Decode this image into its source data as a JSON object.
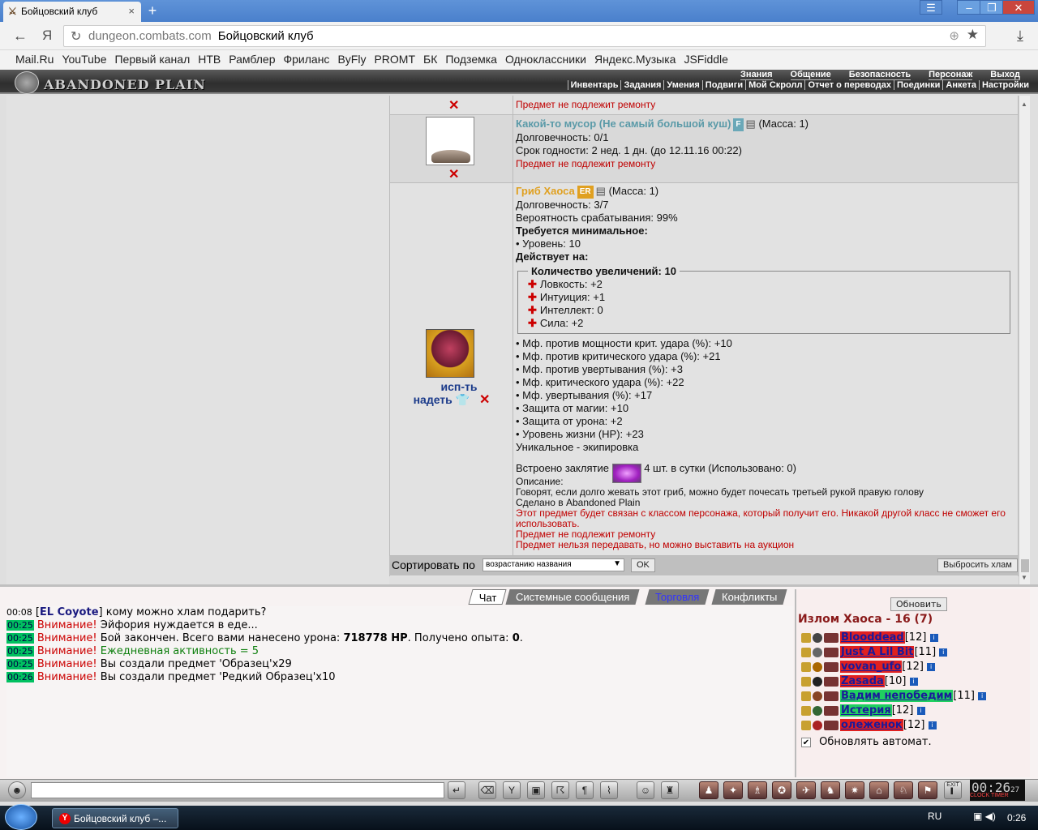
{
  "browser": {
    "tab_title": "Бойцовский клуб",
    "tab_close": "×",
    "new_tab": "+",
    "url_domain": "dungeon.combats.com",
    "url_title": "Бойцовский клуб",
    "yandex_letter": "Я",
    "bookmarks": [
      "Mail.Ru",
      "YouTube",
      "Первый канал",
      "НТВ",
      "Рамблер",
      "Фриланс",
      "ByFly",
      "PROMT",
      "БК",
      "Подземка",
      "Одноклассники",
      "Яндекс.Музыка",
      "JSFiddle"
    ]
  },
  "game": {
    "logo": "ABANDONED PLAIN",
    "top_menu": [
      "Знания",
      "Общение",
      "Безопасность",
      "Персонаж",
      "Выход"
    ],
    "sub_menu": [
      "Инвентарь",
      "Задания",
      "Умения",
      "Подвиги",
      "Мой Скролл",
      "Отчет о переводах",
      "Поединки",
      "Анкета",
      "Настройки"
    ]
  },
  "items": {
    "first_partial": {
      "remove": "✕",
      "no_repair": "Предмет не подлежит ремонту"
    },
    "trash": {
      "name": "Какой-то мусор (Не самый большой куш)",
      "badge": "F",
      "mass": "(Масса: 1)",
      "durability": "Долговечность: 0/1",
      "expiry": "Срок годности: 2 нед. 1 дн. (до 12.11.16 00:22)",
      "no_repair": "Предмет не подлежит ремонту",
      "remove": "✕"
    },
    "mushroom": {
      "name": "Гриб Хаоса",
      "badge": "ER",
      "mass": "(Масса: 1)",
      "durability": "Долговечность: 3/7",
      "chance": "Вероятность срабатывания: 99%",
      "req_title": "Требуется минимальное:",
      "req_level": "• Уровень: 10",
      "acts_title": "Действует на:",
      "upgrades_legend": "Количество увеличений: 10",
      "stats": [
        "Ловкость: +2",
        "Интуиция: +1",
        "Интеллект: 0",
        "Сила: +2"
      ],
      "mods": [
        "• Мф. против мощности крит. удара (%): +10",
        "• Мф. против критического удара (%): +21",
        "• Мф. против увертывания (%): +3",
        "• Мф. критического удара (%): +22",
        "• Мф. увертывания (%): +17",
        "• Защита от магии: +10",
        "• Защита от урона: +2",
        "• Уровень жизни (HP): +23"
      ],
      "unique": "Уникальное - экипировка",
      "spell_prefix": "Встроено заклятие",
      "spell_suffix": "4 шт. в сутки (Использовано: 0)",
      "desc_title": "Описание:",
      "desc": "Говорят, если долго жевать этот гриб, можно будет почесать третьей рукой правую голову",
      "made": "Сделано в Abandoned Plain",
      "bound": "Этот предмет будет связан с классом персонажа, который получит его. Никакой другой класс не сможет его использовать.",
      "no_repair": "Предмет не подлежит ремонту",
      "no_transfer": "Предмет нельзя передавать, но можно выставить на аукцион",
      "use": "исп-ть",
      "wear": "надеть",
      "remove": "✕"
    }
  },
  "sortbar": {
    "label": "Сортировать по",
    "selected": "возрастанию названия",
    "ok": "OK",
    "throw_trash": "Выбросить хлам"
  },
  "chat": {
    "tabs": [
      "Чат",
      "Системные сообщения",
      "Торговля",
      "Конфликты"
    ],
    "lines": [
      {
        "time": "00:08",
        "pre": "[",
        "name": "EL Coyote",
        "post": "] кому можно хлам подарить?"
      },
      {
        "time": "00:25",
        "warn": "Внимание!",
        "text": " Эйфория нуждается в еде..."
      },
      {
        "time": "00:25",
        "warn": "Внимание!",
        "text": " Бой закончен. Всего вами нанесено урона: ",
        "b1": "718778 HP",
        "text2": ". Получено опыта: ",
        "b2": "0",
        "text3": "."
      },
      {
        "time": "00:25",
        "warn": "Внимание!",
        "green": " Ежедневная активность = 5"
      },
      {
        "time": "00:25",
        "warn": "Внимание!",
        "text": " Вы создали предмет 'Образец'x29"
      },
      {
        "time": "00:26",
        "warn": "Внимание!",
        "text": " Вы создали предмет 'Редкий Образец'x10"
      }
    ]
  },
  "room": {
    "refresh": "Обновить",
    "title": "Излом Хаоса - 16 (7)",
    "players": [
      {
        "name": "Blooddead",
        "level": "[12]",
        "bg": "#e02020"
      },
      {
        "name": "Just A Lil Bit",
        "level": "[11]",
        "bg": "#e02020"
      },
      {
        "name": "vovan_ufo",
        "level": "[12]",
        "bg": "#e02020"
      },
      {
        "name": "Zasada",
        "level": "[10]",
        "bg": "#e02020"
      },
      {
        "name": "Вадим непобедим",
        "level": "[11]",
        "bg": "#20d060"
      },
      {
        "name": "Истерия",
        "level": "[12]",
        "bg": "#20d060"
      },
      {
        "name": "олеженок",
        "level": "[12]",
        "bg": "#e02020"
      }
    ],
    "auto_refresh": "Обновлять автомат.",
    "checkmark": "✔"
  },
  "toolbar": {
    "clock": "00:26",
    "clock_sec": "27",
    "clock_label": "CLOCK",
    "timer_label": "TIMER",
    "exit": "EXIT"
  },
  "taskbar": {
    "task": "Бойцовский клуб –...",
    "lang": "RU",
    "time": "0:26"
  }
}
